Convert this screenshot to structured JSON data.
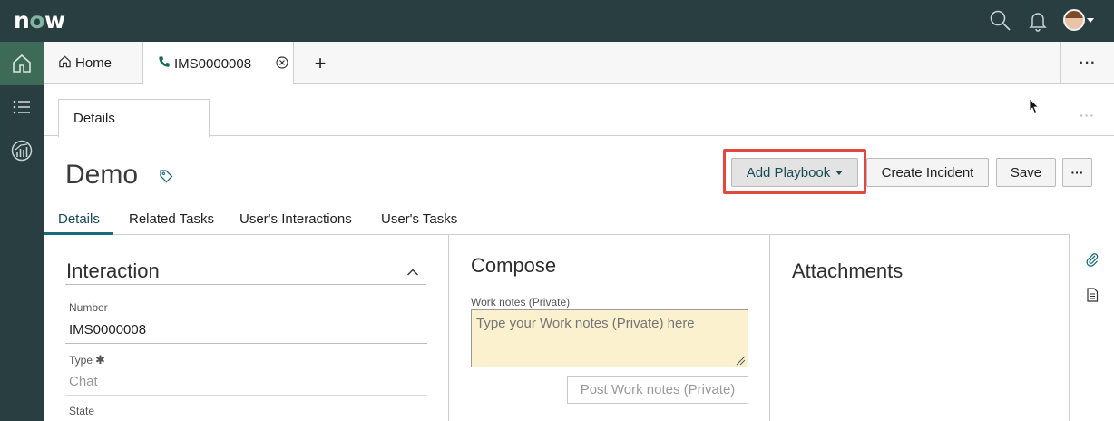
{
  "topbar": {
    "logo": {
      "prefix": "n",
      "o": "o",
      "suffix": "w"
    },
    "icons": [
      "search-icon",
      "bell-icon",
      "avatar"
    ],
    "colors": {
      "background": "#293e40",
      "accent": "#81b5a1"
    }
  },
  "leftnav": {
    "items": [
      "home-icon",
      "list-icon",
      "analytics-icon"
    ],
    "active_color": "#3e6b57"
  },
  "tabs": {
    "items": [
      {
        "label": "Home",
        "icon": "home-icon"
      },
      {
        "label": "IMS0000008",
        "icon": "phone-icon"
      }
    ],
    "add_label": "+",
    "more_label": "···"
  },
  "subtabs": {
    "active": "Details",
    "more_label": "···"
  },
  "record": {
    "title": "Demo"
  },
  "actions": {
    "add_playbook": "Add Playbook",
    "create_incident": "Create Incident",
    "save": "Save",
    "more": "···",
    "highlight_color": "#e2483d"
  },
  "form_tabs": [
    "Details",
    "Related Tasks",
    "User's Interactions",
    "User's Tasks"
  ],
  "interaction": {
    "title": "Interaction",
    "fields": {
      "number_label": "Number",
      "number_value": "IMS0000008",
      "type_label": "Type",
      "type_value": "Chat",
      "state_label": "State"
    }
  },
  "compose": {
    "title": "Compose",
    "work_notes_label": "Work notes (Private)",
    "work_notes_placeholder": "Type your Work notes (Private) here",
    "post_button": "Post Work notes (Private)"
  },
  "attachments": {
    "title": "Attachments"
  },
  "rail": {
    "icons": [
      "paperclip-icon",
      "document-icon"
    ]
  }
}
